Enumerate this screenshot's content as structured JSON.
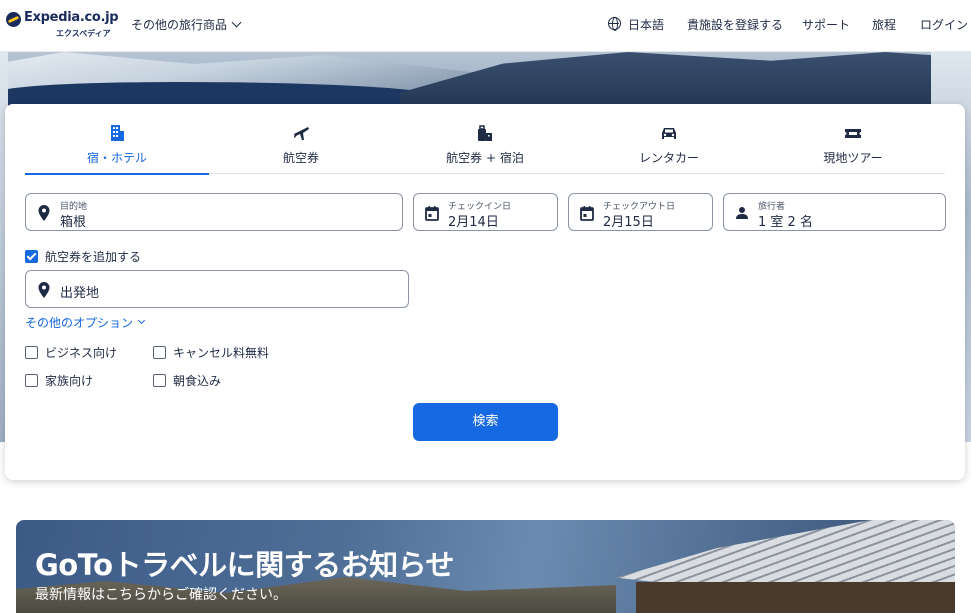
{
  "header": {
    "logo_text": "Expedia.co.jp",
    "logo_sub": "エクスペディア",
    "products_menu": "その他の旅行商品",
    "language": "日本語",
    "list_property": "貴施設を登録する",
    "support": "サポート",
    "trips": "旅程",
    "login": "ログイン"
  },
  "tabs": [
    {
      "label": "宿・ホテル",
      "icon": "hotel-icon",
      "active": true
    },
    {
      "label": "航空券",
      "icon": "plane-icon",
      "active": false
    },
    {
      "label": "航空券 + 宿泊",
      "icon": "package-icon",
      "active": false
    },
    {
      "label": "レンタカー",
      "icon": "car-icon",
      "active": false
    },
    {
      "label": "現地ツアー",
      "icon": "ticket-icon",
      "active": false
    }
  ],
  "search": {
    "destination": {
      "label": "目的地",
      "value": "箱根"
    },
    "checkin": {
      "label": "チェックイン日",
      "value": "2月14日"
    },
    "checkout": {
      "label": "チェックアウト日",
      "value": "2月15日"
    },
    "travelers": {
      "label": "旅行者",
      "value": "1 室 2 名"
    },
    "add_flight": {
      "label": "航空券を追加する",
      "checked": true
    },
    "origin_placeholder": "出発地",
    "more_options": "その他のオプション",
    "options": [
      {
        "label": "ビジネス向け",
        "checked": false
      },
      {
        "label": "キャンセル料無料",
        "checked": false
      },
      {
        "label": "家族向け",
        "checked": false
      },
      {
        "label": "朝食込み",
        "checked": false
      }
    ],
    "submit": "検索"
  },
  "banner": {
    "title": "GoToトラベルに関するお知らせ",
    "subtitle": "最新情報はこちらからご確認ください。"
  },
  "colors": {
    "accent": "#1668e3",
    "brand_navy": "#1b2a5c",
    "text": "#1f2a44"
  }
}
